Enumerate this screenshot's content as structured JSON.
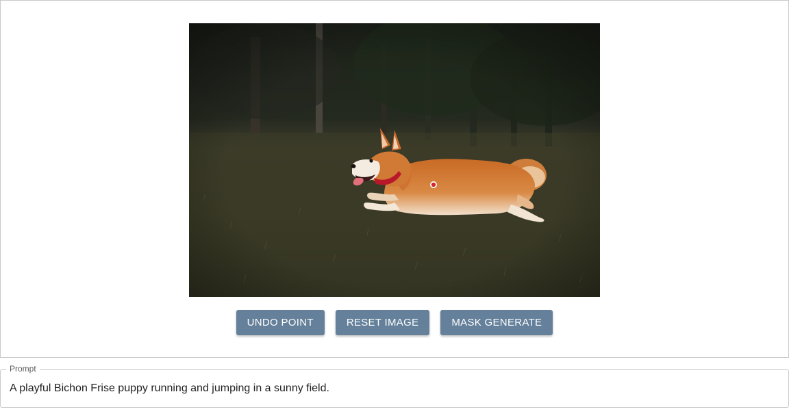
{
  "editor": {
    "image": {
      "subject": "corgi running on grass",
      "selection_point_color": "#d62828"
    },
    "buttons": {
      "undo_label": "UNDO POINT",
      "reset_label": "RESET IMAGE",
      "mask_label": "MASK GENERATE"
    },
    "accent_color": "#64809a"
  },
  "prompt": {
    "label": "Prompt",
    "value": "A playful Bichon Frise puppy running and jumping in a sunny field."
  }
}
